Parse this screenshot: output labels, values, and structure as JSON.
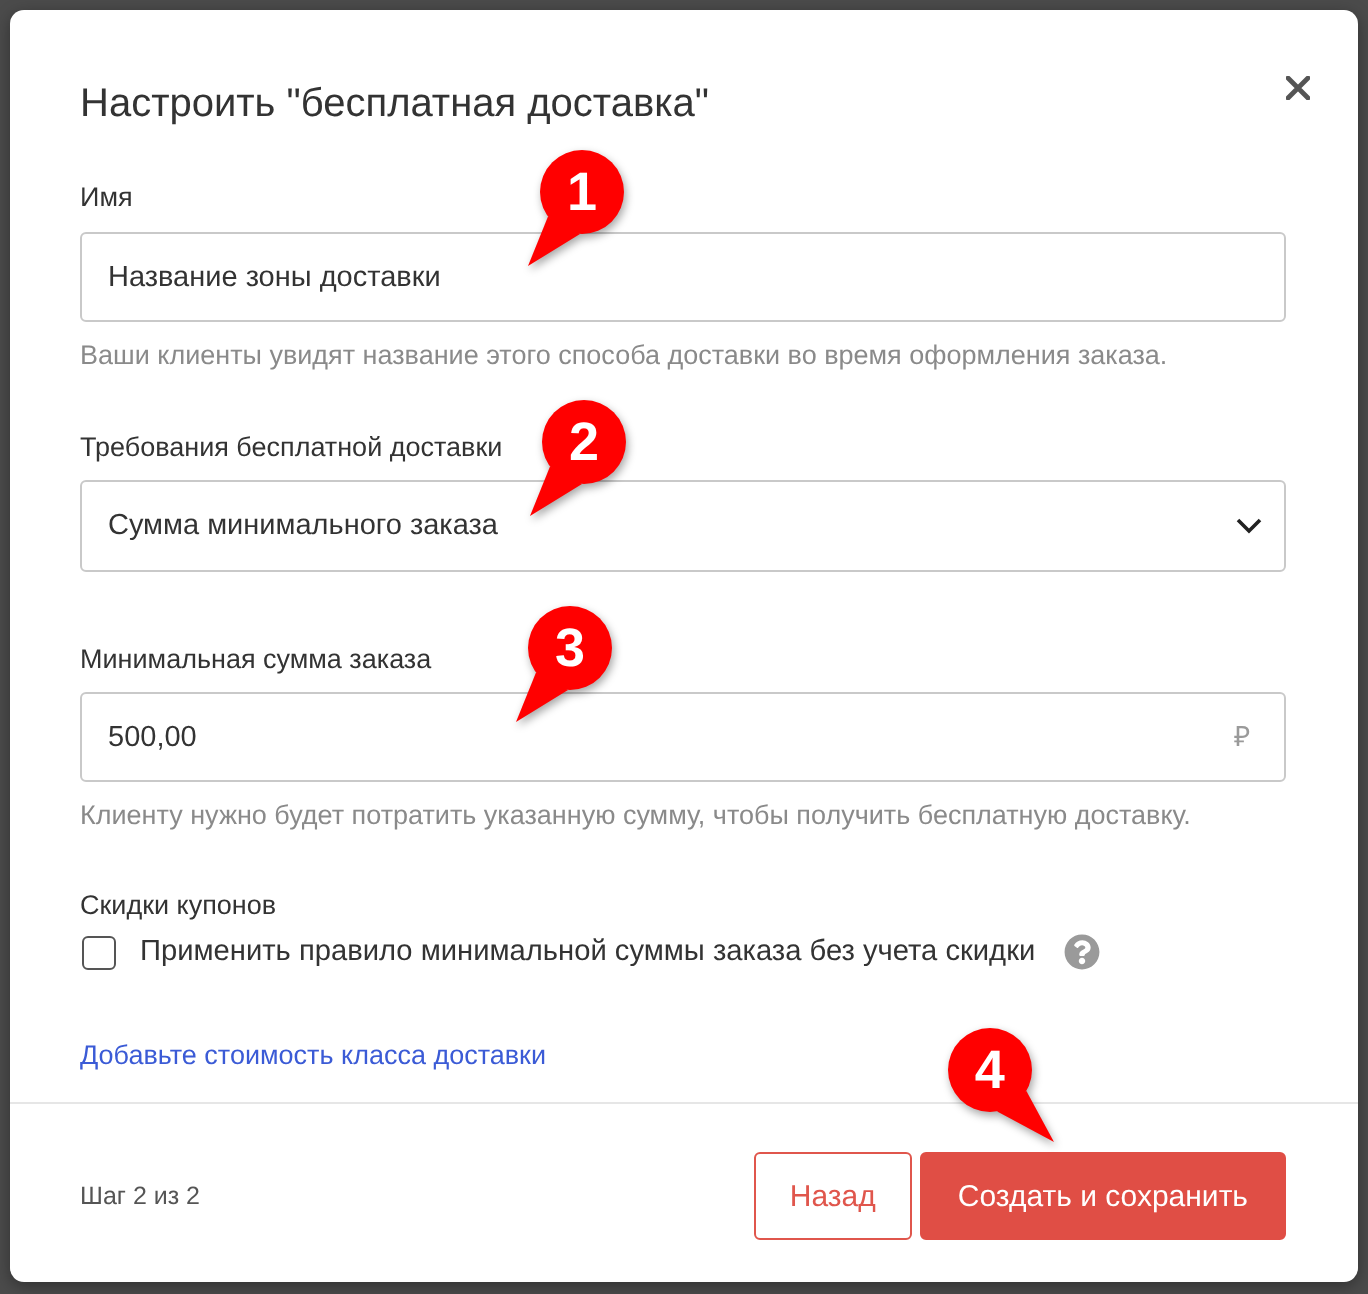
{
  "dialog": {
    "title": "Настроить \"бесплатная доставка\""
  },
  "fields": [
    {
      "kind": "text",
      "label": "Имя",
      "value": "Название зоны доставки",
      "help": "Ваши клиенты увидят название этого способа доставки во время оформления заказа.",
      "callout": "1"
    },
    {
      "kind": "select",
      "label": "Требования бесплатной доставки",
      "value": "Сумма минимального заказа",
      "callout": "2"
    },
    {
      "kind": "currency",
      "label": "Минимальная сумма заказа",
      "value": "500,00",
      "suffix": "₽",
      "help": "Клиенту нужно будет потратить указанную сумму, чтобы получить бесплатную доставку.",
      "callout": "3"
    },
    {
      "kind": "checkbox",
      "label": "Скидки купонов",
      "option": "Применить правило минимальной суммы заказа без учета скидки",
      "checked": false
    }
  ],
  "link": "Добавьте стоимость класса доставки",
  "footer": {
    "step": "Шаг 2 из 2",
    "buttons": [
      {
        "kind": "secondary",
        "label": "Назад"
      },
      {
        "kind": "primary",
        "label": "Создать и сохранить",
        "callout": "4"
      }
    ]
  }
}
